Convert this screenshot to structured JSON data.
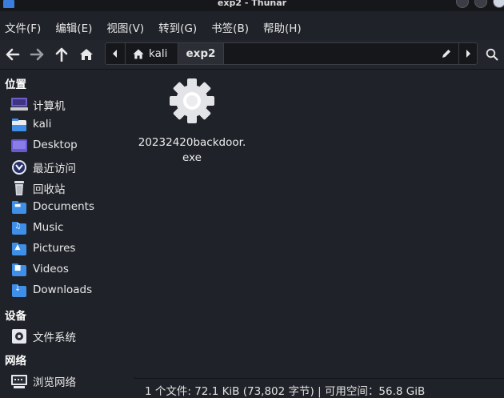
{
  "window": {
    "title": "exp2 - Thunar"
  },
  "menubar": {
    "items": [
      "文件(F)",
      "编辑(E)",
      "视图(V)",
      "转到(G)",
      "书签(B)",
      "帮助(H)"
    ]
  },
  "pathbar": {
    "segments": [
      "kali",
      "exp2"
    ],
    "active": "exp2"
  },
  "sidebar": {
    "sections": [
      {
        "header": "位置",
        "items": [
          {
            "label": "计算机",
            "icon": "computer-icon"
          },
          {
            "label": "kali",
            "icon": "home-folder-icon"
          },
          {
            "label": "Desktop",
            "icon": "desktop-icon"
          },
          {
            "label": "最近访问",
            "icon": "recent-icon"
          },
          {
            "label": "回收站",
            "icon": "trash-icon"
          },
          {
            "label": "Documents",
            "icon": "documents-folder-icon"
          },
          {
            "label": "Music",
            "icon": "music-folder-icon"
          },
          {
            "label": "Pictures",
            "icon": "pictures-folder-icon"
          },
          {
            "label": "Videos",
            "icon": "videos-folder-icon"
          },
          {
            "label": "Downloads",
            "icon": "downloads-folder-icon"
          }
        ]
      },
      {
        "header": "设备",
        "items": [
          {
            "label": "文件系统",
            "icon": "drive-icon"
          }
        ]
      },
      {
        "header": "网络",
        "items": [
          {
            "label": "浏览网络",
            "icon": "network-icon"
          }
        ]
      }
    ]
  },
  "files": [
    {
      "name": "20232420backdoor.exe",
      "icon": "gear-icon"
    }
  ],
  "statusbar": {
    "text": "1 个文件: 72.1 KiB (73,802 字节) | 可用空间：56.8 GiB"
  },
  "colors": {
    "background": "#1f2228",
    "folder": "#3f8ee8",
    "accent": "#3b7ddd"
  }
}
